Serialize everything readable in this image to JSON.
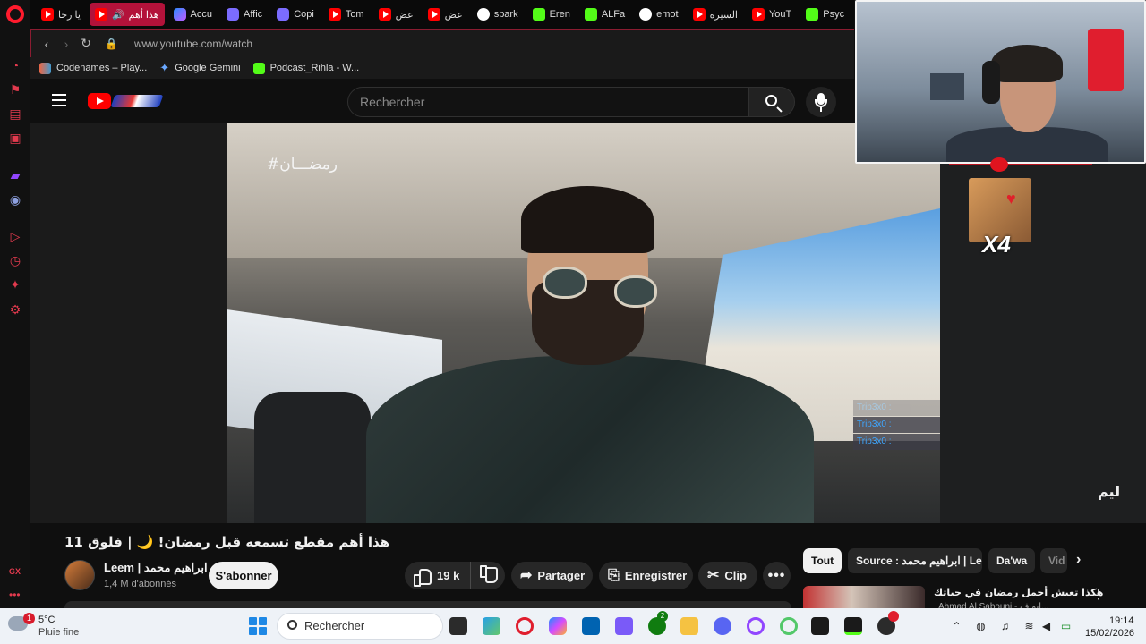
{
  "browser": {
    "tabs": [
      {
        "label": "يا رجا"
      },
      {
        "label": "هذا أهم"
      },
      {
        "label": "Accu"
      },
      {
        "label": "Affic"
      },
      {
        "label": "Copi"
      },
      {
        "label": "Tom"
      },
      {
        "label": "عض"
      },
      {
        "label": "عض"
      },
      {
        "label": "spark"
      },
      {
        "label": "Eren"
      },
      {
        "label": "ALFa"
      },
      {
        "label": "emot"
      },
      {
        "label": "السيرة"
      },
      {
        "label": "YouT"
      },
      {
        "label": "Psyc"
      }
    ],
    "address": {
      "url": "www.youtube.com/watch"
    },
    "bookmarks": [
      {
        "label": "Codenames – Play..."
      },
      {
        "label": "Google Gemini"
      },
      {
        "label": "Podcast_Rihla - W..."
      }
    ]
  },
  "youtube": {
    "search_placeholder": "Rechercher",
    "video": {
      "overlay_hashtag": "#رمضـــان",
      "title": "هذا أهم مقطع تسمعه قبل رمضان! 🌙 | فلوق 11",
      "channel_name": "Leem | ابراهيم محمد",
      "subscribers": "1,4 M d'abonnés",
      "subscribe_label": "S'abonner",
      "likes": "19 k",
      "share_label": "Partager",
      "save_label": "Enregistrer",
      "clip_label": "Clip",
      "more_label": "•••",
      "watermark": "ليم"
    },
    "chips": [
      {
        "label": "Tout"
      },
      {
        "label": "Source : ابراهيم محمد | Leem"
      },
      {
        "label": "Da'wa"
      },
      {
        "label": "Vid"
      }
    ],
    "recommendation": {
      "title": "هكذا تعيش أجمل رمضان في حياتك",
      "channel": "Ahmad Al Sabouni - ابو ف..."
    }
  },
  "stream_overlay": {
    "emote_multiplier": "X4",
    "chat": [
      {
        "user": "Trip3x0",
        "text": ":"
      },
      {
        "user": "Trip3x0",
        "text": ":"
      },
      {
        "user": "Trip3x0",
        "text": ":"
      }
    ]
  },
  "taskbar": {
    "weather_temp": "5°C",
    "weather_desc": "Pluie fine",
    "weather_badge": "1",
    "search_placeholder": "Rechercher",
    "xbox_badge": "2",
    "time": "19:14",
    "date": "15/02/2026"
  },
  "colors": {
    "accent": "#ff0000",
    "opera_red": "#ff1b2d",
    "active_tab": "#b3123a",
    "link_blue": "#3ea6ff"
  }
}
